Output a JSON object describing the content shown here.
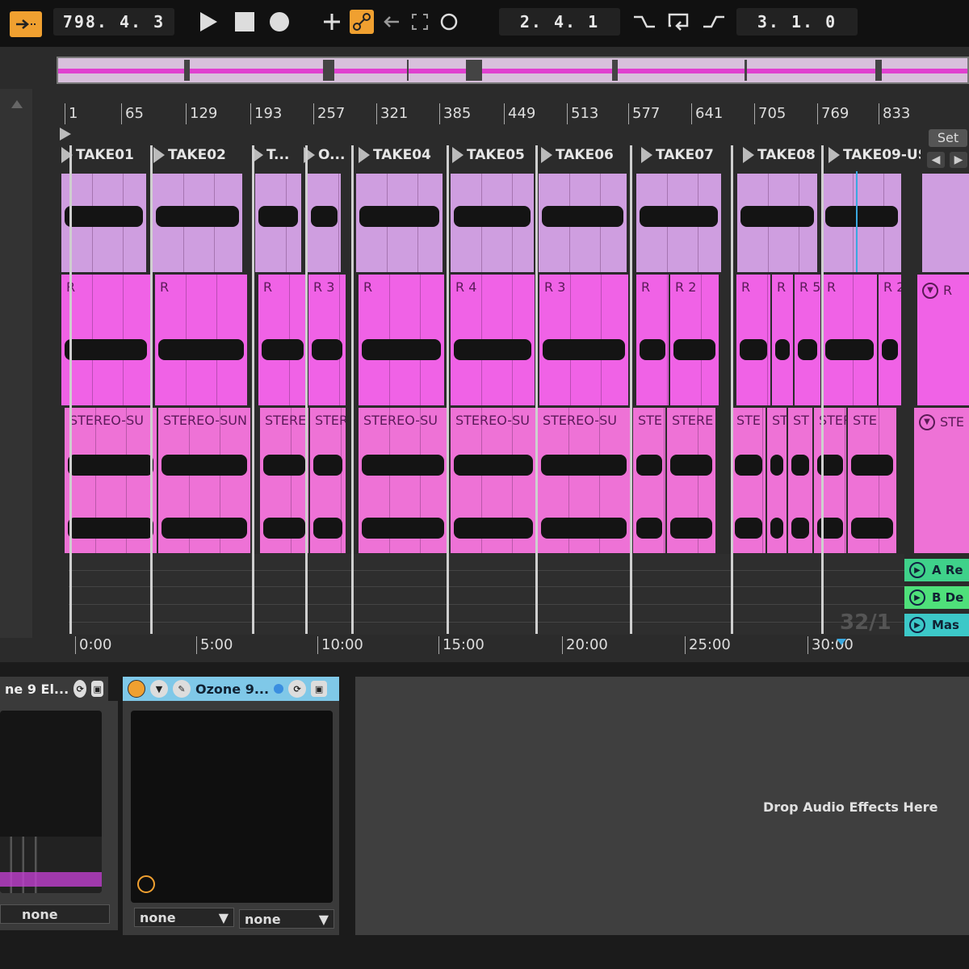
{
  "transport": {
    "position": "798. 4. 3",
    "punch_in": "2. 4. 1",
    "loop_length": "3. 1. 0",
    "icons": [
      "follow-icon",
      "play-icon",
      "stop-icon",
      "record-icon",
      "add-icon",
      "automation-icon",
      "back-icon",
      "capture-icon",
      "loop-circle-icon",
      "punch-in-icon",
      "loop-icon",
      "punch-out-icon"
    ]
  },
  "ruler": {
    "bar_ticks": [
      "1",
      "65",
      "129",
      "193",
      "257",
      "321",
      "385",
      "449",
      "513",
      "577",
      "641",
      "705",
      "769",
      "833"
    ],
    "time_ticks": [
      "0:00",
      "5:00",
      "10:00",
      "15:00",
      "20:00",
      "25:00",
      "30:00"
    ],
    "set_label": "Set",
    "bar_counter": "32/1"
  },
  "locators": [
    "TAKE01",
    "TAKE02",
    "T...",
    "O...",
    "TAKE04",
    "TAKE05",
    "TAKE06",
    "TAKE07",
    "TAKE08",
    "TAKE09-US"
  ],
  "tracks": {
    "track2_labels": [
      "R",
      "R",
      "R",
      "R 3",
      "R",
      "R 4",
      "R 3",
      "R",
      "R 2",
      "R",
      "R",
      "R 5",
      "R",
      "R 2"
    ],
    "track2_side_label": "R",
    "track3_labels": [
      "STEREO-SU",
      "STEREO-SUN",
      "STERE",
      "STER",
      "STEREO-SU",
      "STEREO-SU",
      "STEREO-SU",
      "STE",
      "STERE",
      "STE",
      "ST",
      "ST",
      "STERE",
      "STE"
    ],
    "track3_side_label": "STE",
    "returns": [
      {
        "label": "A Re",
        "color": "#3fd18a"
      },
      {
        "label": "B De",
        "color": "#4fe07a"
      },
      {
        "label": "Mas",
        "color": "#3cc8c8"
      }
    ]
  },
  "devices": {
    "device1_title": "ne 9 El...",
    "device1_select": "none",
    "device2_title": "Ozone 9...",
    "device2_select_a": "none",
    "device2_select_b": "none",
    "drop_hint": "Drop Audio Effects Here",
    "accent": "#f0a030",
    "device_header_color": "#7fc8e8"
  }
}
